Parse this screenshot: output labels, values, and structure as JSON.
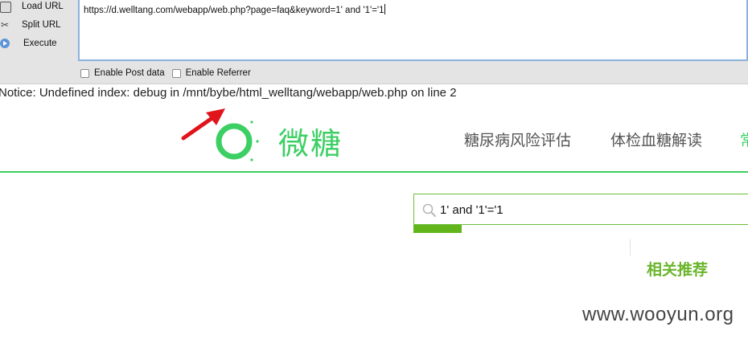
{
  "hackbar": {
    "menu": {
      "load_url": "Load URL",
      "split_url": "Split URL",
      "execute": "Execute"
    },
    "url_value": "https://d.welltang.com/webapp/web.php?page=faq&keyword=1' and '1'='1",
    "checks": {
      "post": "Enable Post data",
      "referrer": "Enable Referrer"
    }
  },
  "notice": "Notice: Undefined index: debug in /mnt/bybe/html_welltang/webapp/web.php on line 2",
  "site": {
    "logo_text": "微糖",
    "nav": [
      "糖尿病风险评估",
      "体检血糖解读",
      "常"
    ],
    "accent": "#3ccf63"
  },
  "search": {
    "value": "1' and '1'='1",
    "icon": "search-icon"
  },
  "recommend_title": "相关推荐",
  "watermark": "www.wooyun.org"
}
